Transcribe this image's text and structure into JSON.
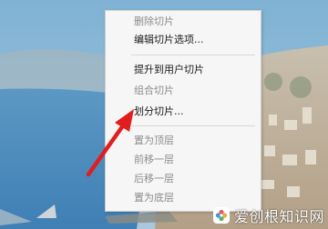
{
  "context_menu": {
    "items": [
      {
        "label": "删除切片",
        "enabled": false
      },
      {
        "label": "编辑切片选项...",
        "enabled": true
      },
      {
        "label": "提升到用户切片",
        "enabled": true
      },
      {
        "label": "组合切片",
        "enabled": false
      },
      {
        "label": "划分切片...",
        "enabled": true
      },
      {
        "label": "置为顶层",
        "enabled": false
      },
      {
        "label": "前移一层",
        "enabled": false
      },
      {
        "label": "后移一层",
        "enabled": false
      },
      {
        "label": "置为底层",
        "enabled": false
      }
    ]
  },
  "annotation": {
    "arrow_color": "#e11d1d"
  },
  "watermark": {
    "text": "爱创根知识网",
    "logo_icon": "flower-logo-icon"
  }
}
